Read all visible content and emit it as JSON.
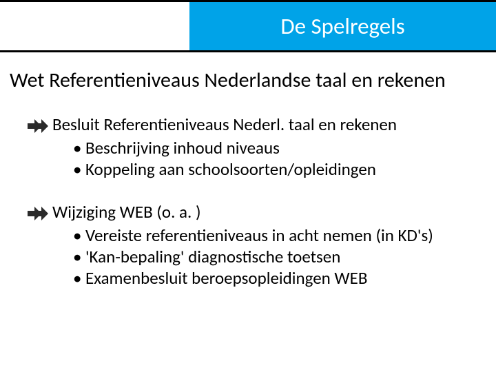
{
  "header": {
    "title": "De  Spelregels"
  },
  "subheader": "Wet Referentieniveaus Nederlandse taal en rekenen",
  "sections": [
    {
      "heading": "Besluit Referentieniveaus Nederl. taal en rekenen",
      "bullets": [
        "Beschrijving inhoud niveaus",
        "Koppeling aan schoolsoorten/opleidingen"
      ]
    },
    {
      "heading": "Wijziging WEB (o. a. )",
      "bullets": [
        "Vereiste referentieniveaus in acht nemen (in KD's)",
        "'Kan-bepaling' diagnostische toetsen",
        "Examenbesluit beroepsopleidingen WEB"
      ]
    }
  ],
  "bullet_char": "•"
}
